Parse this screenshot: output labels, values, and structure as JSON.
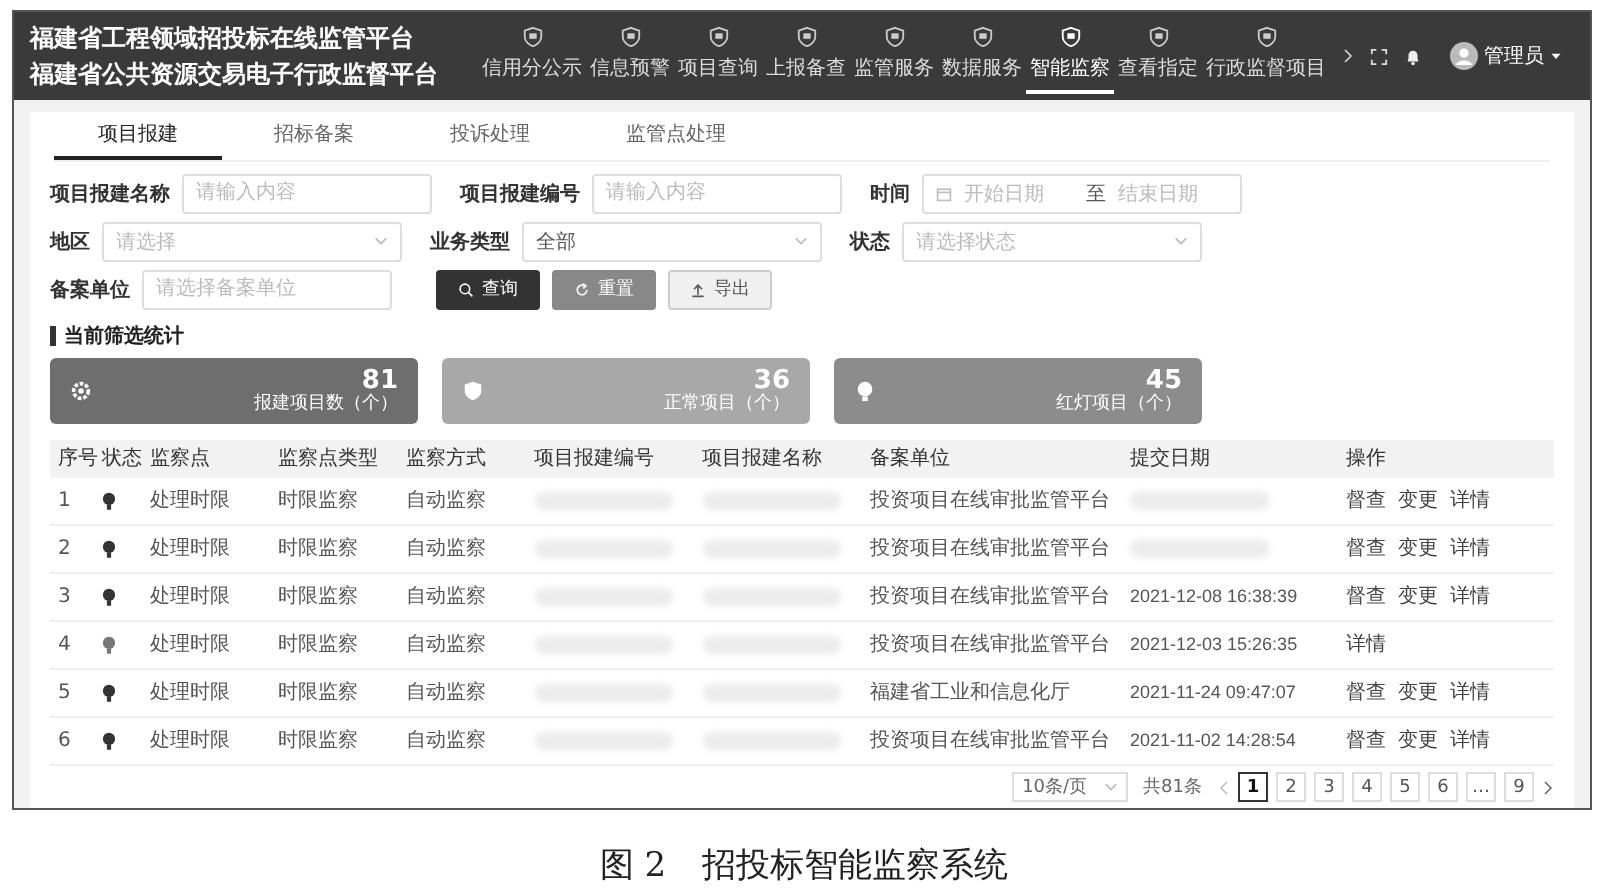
{
  "header": {
    "title_lines": [
      "福建省工程领域招投标在线监管平台",
      "福建省公共资源交易电子行政监督平台"
    ],
    "nav": [
      {
        "label": "信用分公示",
        "selected": false
      },
      {
        "label": "信息预警",
        "selected": false
      },
      {
        "label": "项目查询",
        "selected": false
      },
      {
        "label": "上报备查",
        "selected": false
      },
      {
        "label": "监管服务",
        "selected": false
      },
      {
        "label": "数据服务",
        "selected": false
      },
      {
        "label": "智能监察",
        "selected": true
      },
      {
        "label": "查看指定",
        "selected": false
      },
      {
        "label": "行政监督项目",
        "selected": false
      }
    ],
    "user": "管理员"
  },
  "tabs": [
    {
      "label": "项目报建",
      "selected": true
    },
    {
      "label": "招标备案",
      "selected": false
    },
    {
      "label": "投诉处理",
      "selected": false
    },
    {
      "label": "监管点处理",
      "selected": false
    }
  ],
  "filters": [
    {
      "kind": "text",
      "label": "项目报建名称",
      "placeholder": "请输入内容"
    },
    {
      "kind": "text",
      "label": "项目报建编号",
      "placeholder": "请输入内容"
    },
    {
      "kind": "daterange",
      "label": "时间",
      "placeholder": "开始日期",
      "separator": "至",
      "placeholder_end": "结束日期"
    },
    {
      "kind": "select",
      "label": "地区",
      "placeholder": "请选择"
    },
    {
      "kind": "select",
      "label": "业务类型",
      "value": "全部"
    },
    {
      "kind": "select",
      "label": "状态",
      "placeholder": "请选择状态"
    },
    {
      "kind": "text",
      "label": "备案单位",
      "placeholder": "请选择备案单位"
    }
  ],
  "buttons": [
    {
      "kind": "primary",
      "label": "查询"
    },
    {
      "kind": "secondary",
      "label": "重置"
    },
    {
      "kind": "plain",
      "label": "导出"
    }
  ],
  "section_title": "当前筛选统计",
  "stats": [
    {
      "value": "81",
      "label": "报建项目数（个）",
      "color": "#6e6e6e"
    },
    {
      "value": "36",
      "label": "正常项目（个）",
      "color": "#a8a8a8"
    },
    {
      "value": "45",
      "label": "红灯项目（个）",
      "color": "#8c8c8c"
    }
  ],
  "table": {
    "columns": [
      "序号",
      "状态",
      "监察点",
      "监察点类型",
      "监察方式",
      "项目报建编号",
      "项目报建名称",
      "备案单位",
      "提交日期",
      "操作"
    ],
    "rows": [
      {
        "index": "1",
        "color": "#333333",
        "point": "处理时限",
        "type": "时限监察",
        "method": "自动监察",
        "unit": "投资项目在线审批监管平台",
        "date": null,
        "actions": [
          "督查",
          "变更",
          "详情"
        ]
      },
      {
        "index": "2",
        "color": "#333333",
        "point": "处理时限",
        "type": "时限监察",
        "method": "自动监察",
        "unit": "投资项目在线审批监管平台",
        "date": null,
        "actions": [
          "督查",
          "变更",
          "详情"
        ]
      },
      {
        "index": "3",
        "color": "#333333",
        "point": "处理时限",
        "type": "时限监察",
        "method": "自动监察",
        "unit": "投资项目在线审批监管平台",
        "date": "2021-12-08 16:38:39",
        "actions": [
          "督查",
          "变更",
          "详情"
        ]
      },
      {
        "index": "4",
        "color": "#777777",
        "point": "处理时限",
        "type": "时限监察",
        "method": "自动监察",
        "unit": "投资项目在线审批监管平台",
        "date": "2021-12-03 15:26:35",
        "actions": [
          "详情"
        ]
      },
      {
        "index": "5",
        "color": "#333333",
        "point": "处理时限",
        "type": "时限监察",
        "method": "自动监察",
        "unit": "福建省工业和信息化厅",
        "date": "2021-11-24 09:47:07",
        "actions": [
          "督查",
          "变更",
          "详情"
        ]
      },
      {
        "index": "6",
        "color": "#333333",
        "point": "处理时限",
        "type": "时限监察",
        "method": "自动监察",
        "unit": "投资项目在线审批监管平台",
        "date": "2021-11-02 14:28:54",
        "actions": [
          "督查",
          "变更",
          "详情"
        ]
      }
    ]
  },
  "pagination": {
    "page_size": "10条/页",
    "total": "共81条",
    "pages": [
      {
        "label": "1",
        "selected": true
      },
      {
        "label": "2",
        "selected": false
      },
      {
        "label": "3",
        "selected": false
      },
      {
        "label": "4",
        "selected": false
      },
      {
        "label": "5",
        "selected": false
      },
      {
        "label": "6",
        "selected": false
      },
      {
        "label": "…",
        "selected": false
      },
      {
        "label": "9",
        "selected": false
      }
    ]
  },
  "caption": {
    "label": "图 2",
    "text": "招投标智能监察系统"
  }
}
